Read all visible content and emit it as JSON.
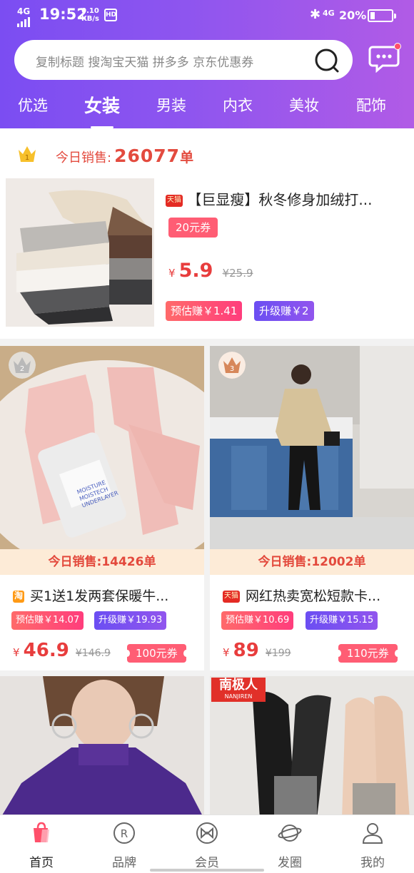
{
  "status": {
    "net": "4G",
    "time": "19:52",
    "speed_value": "0.10",
    "speed_unit": "KB/s",
    "hd_label": "HD",
    "signal2": "4G",
    "battery_pct": "20%",
    "battery_level": 0.2
  },
  "search": {
    "placeholder": "复制标题 搜淘宝天猫 拼多多 京东优惠券"
  },
  "tabs": [
    "优选",
    "女装",
    "男装",
    "内衣",
    "美妆",
    "配饰"
  ],
  "active_tab": "女装",
  "featured": {
    "rank": "1",
    "today_label": "今日销售:",
    "today_count": "26077",
    "today_unit": "单",
    "shop_tag": "天猫",
    "title": "【巨显瘦】秋冬修身加绒打...",
    "coupon": "20元券",
    "yen": "¥",
    "price": "5.9",
    "old_price": "¥25.9",
    "est": "预估赚￥1.41",
    "upgrade": "升级赚￥2"
  },
  "grid": [
    {
      "rank": "2",
      "sales": "今日销售:14426单",
      "shop_tag": "淘",
      "title": "买1送1发两套保暖牛...",
      "est": "预估赚￥14.07",
      "upgrade": "升级赚￥19.93",
      "yen": "¥",
      "price": "46.9",
      "old_price": "¥146.9",
      "coupon": "100元券",
      "img_text": [
        "MOISTURE",
        "MOISTECH",
        "UNDERLAYER"
      ]
    },
    {
      "rank": "3",
      "sales": "今日销售:12002单",
      "shop_tag": "天猫",
      "title": "网红热卖宽松短款卡...",
      "est": "预估赚￥10.69",
      "upgrade": "升级赚￥15.15",
      "yen": "¥",
      "price": "89",
      "old_price": "¥199",
      "coupon": "110元券"
    }
  ],
  "bottom_brand": {
    "name": "南极人",
    "sub": "NANJIREN"
  },
  "nav": [
    "首页",
    "品牌",
    "会员",
    "发圈",
    "我的"
  ],
  "colors": {
    "accent": "#8e55ef",
    "price": "#e83d3d",
    "coupon": "#ff5d74"
  }
}
